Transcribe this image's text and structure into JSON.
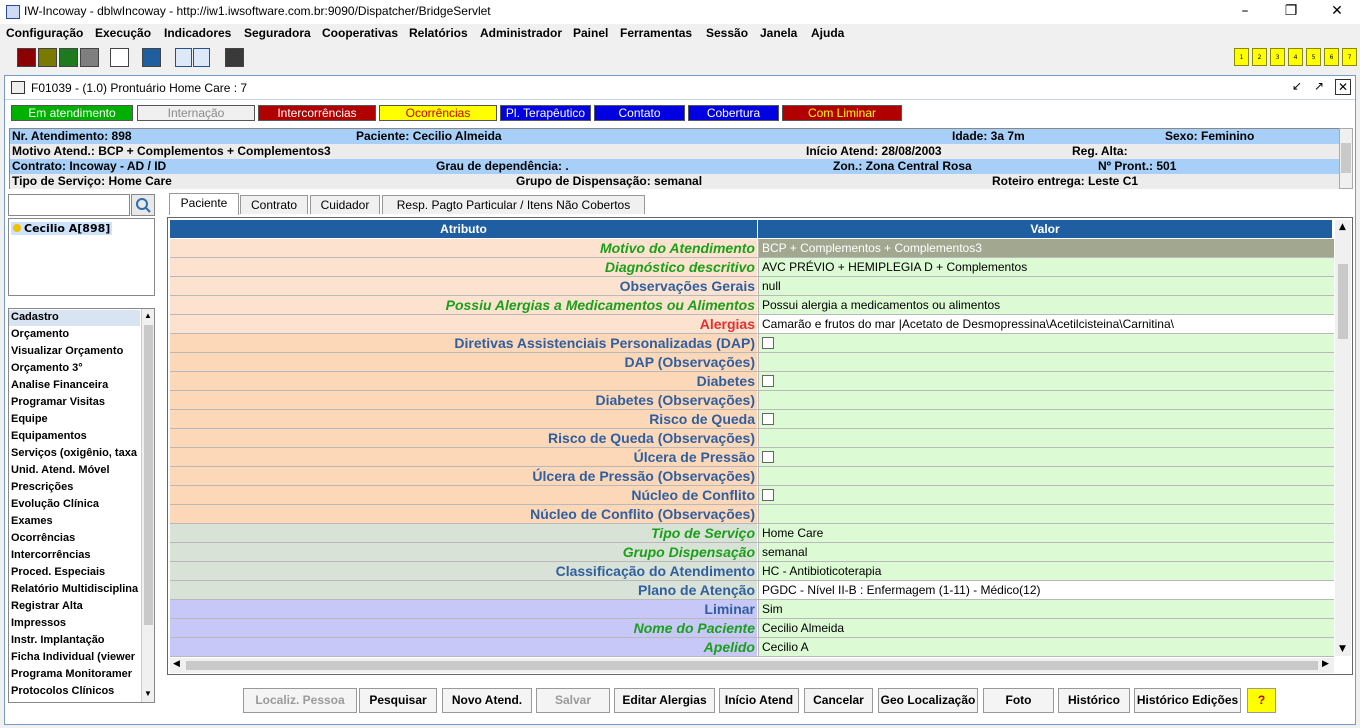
{
  "window": {
    "title": "IW-Incoway - dblwIncoway - http://iw1.iwsoftware.com.br:9090/Dispatcher/BridgeServlet"
  },
  "menu": [
    "Configuração",
    "Execução",
    "Indicadores",
    "Seguradora",
    "Cooperativas",
    "Relatórios",
    "Administrador",
    "Painel",
    "Ferramentas",
    "Sessão",
    "Janela",
    "Ajuda"
  ],
  "toolbar": {
    "swatches": [
      "#8b0000",
      "#7a7a00",
      "#1f7a1f",
      "#7f7f7f",
      "#ffffff",
      "#1f5f9f",
      "#3a3a3a"
    ],
    "numbers": [
      "1",
      "2",
      "3",
      "4",
      "5",
      "6",
      "7"
    ]
  },
  "frame": {
    "title": "F01039 - (1.0) Prontuário Home Care : 7"
  },
  "status_tabs": [
    {
      "label": "Em atendimento",
      "bg": "#00b000",
      "fg": "#ffffff"
    },
    {
      "label": "Internação",
      "bg": "#f0f0f0",
      "fg": "#8a8a8a"
    },
    {
      "label": "Intercorrências",
      "bg": "#b00000",
      "fg": "#ffffff"
    },
    {
      "label": "Ocorrências",
      "bg": "#ffff00",
      "fg": "#c00000"
    },
    {
      "label": "Pl. Terapêutico",
      "bg": "#0000e0",
      "fg": "#ffffff"
    },
    {
      "label": "Contato",
      "bg": "#0000e0",
      "fg": "#ffffff"
    },
    {
      "label": "Cobertura",
      "bg": "#0000e0",
      "fg": "#ffffff"
    },
    {
      "label": "Com Liminar",
      "bg": "#b00000",
      "fg": "#ffff00"
    }
  ],
  "info": {
    "r1": {
      "a": "Nr. Atendimento: 898",
      "b": "Paciente: Cecilio Almeida",
      "c": "Idade: 3a 7m",
      "d": "Sexo: Feminino"
    },
    "r2": {
      "a": "Motivo Atend.: BCP + Complementos + Complementos3",
      "b": "Início Atend: 28/08/2003",
      "c": "Reg. Alta:"
    },
    "r3": {
      "a": "Contrato: Incoway - AD / ID",
      "b": "Grau de dependência: .",
      "c": "Zon.: Zona Central Rosa",
      "d": "Nº Pront.: 501"
    },
    "r4": {
      "a": "Tipo de Serviço: Home Care",
      "b": "Grupo de Dispensação: semanal",
      "c": "Roteiro entrega: Leste C1"
    }
  },
  "patient": {
    "name": "Cecilio A[898]"
  },
  "left_menu": [
    "Cadastro",
    "Orçamento",
    "Visualizar Orçamento",
    "Orçamento 3°",
    "Analise Financeira",
    "Programar Visitas",
    "Equipe",
    "Equipamentos",
    "Serviços (oxigênio, taxa",
    "Unid. Atend. Móvel",
    "Prescrições",
    "Evolução Clínica",
    "Exames",
    "Ocorrências",
    "Intercorrências",
    "Proced. Especiais",
    "Relatório Multidisciplina",
    "Registrar Alta",
    "Impressos",
    "Instr. Implantação",
    "Ficha Individual (viewer",
    "Programa Monitoramer",
    "Protocolos Clínicos"
  ],
  "tabs": [
    "Paciente",
    "Contrato",
    "Cuidador",
    "Resp. Pagto Particular / Itens Não Cobertos"
  ],
  "grid": {
    "headers": [
      "Atributo",
      "Valor"
    ],
    "rows": [
      {
        "attr": "Motivo do Atendimento",
        "val": "BCP + Complementos + Complementos3",
        "style": "req",
        "abg": "#fde3cf",
        "vbg": "#a2a890",
        "vfg": "#ffffff",
        "cb": false
      },
      {
        "attr": "Diagnóstico descritivo",
        "val": "AVC PRÉVIO + HEMIPLEGIA D + Complementos",
        "style": "req",
        "abg": "#fde3cf",
        "vbg": "#dcfad4",
        "cb": false
      },
      {
        "attr": "Observações Gerais",
        "val": "null",
        "style": "norm",
        "abg": "#fde3cf",
        "vbg": "#dcfad4",
        "cb": false
      },
      {
        "attr": "Possiu Alergias a Medicamentos ou Alimentos",
        "val": "Possui alergia a medicamentos ou alimentos",
        "style": "req",
        "abg": "#fde3cf",
        "vbg": "#dcfad4",
        "cb": false
      },
      {
        "attr": "Alergias",
        "val": "Camarão e frutos do mar |Acetato de Desmopressina\\Acetilcisteina\\Carnitina\\",
        "style": "red",
        "abg": "#fde3cf",
        "vbg": "#ffffff",
        "cb": false
      },
      {
        "attr": "Diretivas Assistenciais Personalizadas (DAP)",
        "val": "",
        "style": "norm",
        "abg": "#fcd7b8",
        "vbg": "#dcfad4",
        "cb": true
      },
      {
        "attr": "DAP (Observações)",
        "val": "",
        "style": "norm",
        "abg": "#fcd7b8",
        "vbg": "#dcfad4",
        "cb": false
      },
      {
        "attr": "Diabetes",
        "val": "",
        "style": "norm",
        "abg": "#fcd7b8",
        "vbg": "#dcfad4",
        "cb": true
      },
      {
        "attr": "Diabetes (Observações)",
        "val": "",
        "style": "norm",
        "abg": "#fcd7b8",
        "vbg": "#dcfad4",
        "cb": false
      },
      {
        "attr": "Risco de Queda",
        "val": "",
        "style": "norm",
        "abg": "#fcd7b8",
        "vbg": "#dcfad4",
        "cb": true
      },
      {
        "attr": "Risco de Queda (Observações)",
        "val": "",
        "style": "norm",
        "abg": "#fcd7b8",
        "vbg": "#dcfad4",
        "cb": false
      },
      {
        "attr": "Úlcera de Pressão",
        "val": "",
        "style": "norm",
        "abg": "#fcd7b8",
        "vbg": "#dcfad4",
        "cb": true
      },
      {
        "attr": "Úlcera de Pressão (Observações)",
        "val": "",
        "style": "norm",
        "abg": "#fcd7b8",
        "vbg": "#dcfad4",
        "cb": false
      },
      {
        "attr": "Núcleo de Conflito",
        "val": "",
        "style": "norm",
        "abg": "#fcd7b8",
        "vbg": "#dcfad4",
        "cb": true
      },
      {
        "attr": "Núcleo de Conflito (Observações)",
        "val": "",
        "style": "norm",
        "abg": "#fcd7b8",
        "vbg": "#dcfad4",
        "cb": false
      },
      {
        "attr": "Tipo de Serviço",
        "val": "Home Care",
        "style": "req",
        "abg": "#d9e2d6",
        "vbg": "#dcfad4",
        "cb": false
      },
      {
        "attr": "Grupo Dispensação",
        "val": "semanal",
        "style": "req",
        "abg": "#d9e2d6",
        "vbg": "#dcfad4",
        "cb": false
      },
      {
        "attr": "Classificação do Atendimento",
        "val": "HC - Antibioticoterapia",
        "style": "norm",
        "abg": "#d9e2d6",
        "vbg": "#dcfad4",
        "cb": false
      },
      {
        "attr": "Plano de Atenção",
        "val": "PGDC - Nível II-B : Enfermagem (1-11) - Médico(12)",
        "style": "norm",
        "abg": "#d9e2d6",
        "vbg": "#ffffff",
        "cb": false
      },
      {
        "attr": "Liminar",
        "val": "Sim",
        "style": "norm",
        "abg": "#c8c8f8",
        "vbg": "#dcfad4",
        "cb": false
      },
      {
        "attr": "Nome do Paciente",
        "val": "Cecilio Almeida",
        "style": "req",
        "abg": "#c8c8f8",
        "vbg": "#dcfad4",
        "cb": false
      },
      {
        "attr": "Apelido",
        "val": "Cecilio A",
        "style": "req",
        "abg": "#c8c8f8",
        "vbg": "#dcfad4",
        "cb": false
      }
    ]
  },
  "buttons": [
    {
      "label": "Localiz. Pessoa",
      "enabled": false
    },
    {
      "label": "Pesquisar",
      "enabled": true
    },
    {
      "label": "Novo Atend.",
      "enabled": true
    },
    {
      "label": "Salvar",
      "enabled": false
    },
    {
      "label": "Editar Alergias",
      "enabled": true
    },
    {
      "label": "Início Atend",
      "enabled": true
    },
    {
      "label": "Cancelar",
      "enabled": true
    },
    {
      "label": "Geo Localização",
      "enabled": true
    },
    {
      "label": "Foto",
      "enabled": true
    },
    {
      "label": "Histórico",
      "enabled": true
    },
    {
      "label": "Histórico Edições",
      "enabled": true
    },
    {
      "label": "?",
      "enabled": true
    }
  ],
  "colors": {
    "req_text": "#1aa01a",
    "norm_text": "#2f5f9f",
    "red_text": "#e03030",
    "header_bg": "#1f5fa1",
    "info_bg_a": "#a7cff7",
    "info_bg_b": "#ececec"
  }
}
